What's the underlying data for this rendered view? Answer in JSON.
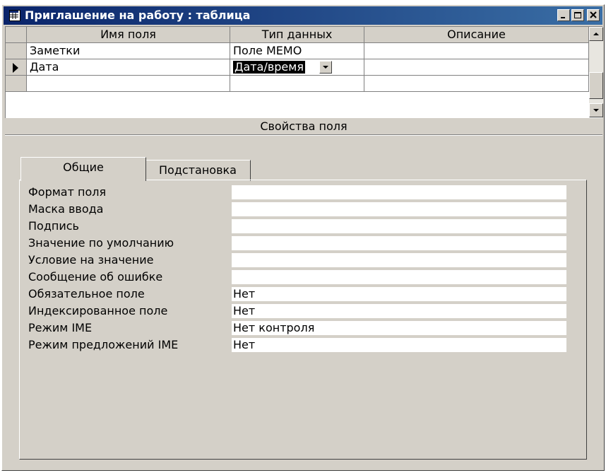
{
  "window": {
    "title": "Приглашение на работу : таблица"
  },
  "grid": {
    "headers": [
      "Имя поля",
      "Тип данных",
      "Описание"
    ],
    "rows": [
      {
        "name": "Заметки",
        "type": "Поле MEMO",
        "description": ""
      },
      {
        "name": "Дата",
        "type": "Дата/время",
        "description": ""
      },
      {
        "name": "",
        "type": "",
        "description": ""
      }
    ]
  },
  "properties": {
    "title": "Свойства поля",
    "tabs": [
      "Общие",
      "Подстановка"
    ],
    "items": [
      {
        "label": "Формат поля",
        "value": ""
      },
      {
        "label": "Маска ввода",
        "value": ""
      },
      {
        "label": "Подпись",
        "value": ""
      },
      {
        "label": "Значение по умолчанию",
        "value": ""
      },
      {
        "label": "Условие на значение",
        "value": ""
      },
      {
        "label": "Сообщение об ошибке",
        "value": ""
      },
      {
        "label": "Обязательное поле",
        "value": "Нет"
      },
      {
        "label": "Индексированное поле",
        "value": "Нет"
      },
      {
        "label": "Режим IME",
        "value": "Нет контроля"
      },
      {
        "label": "Режим предложений IME",
        "value": "Нет"
      }
    ]
  }
}
